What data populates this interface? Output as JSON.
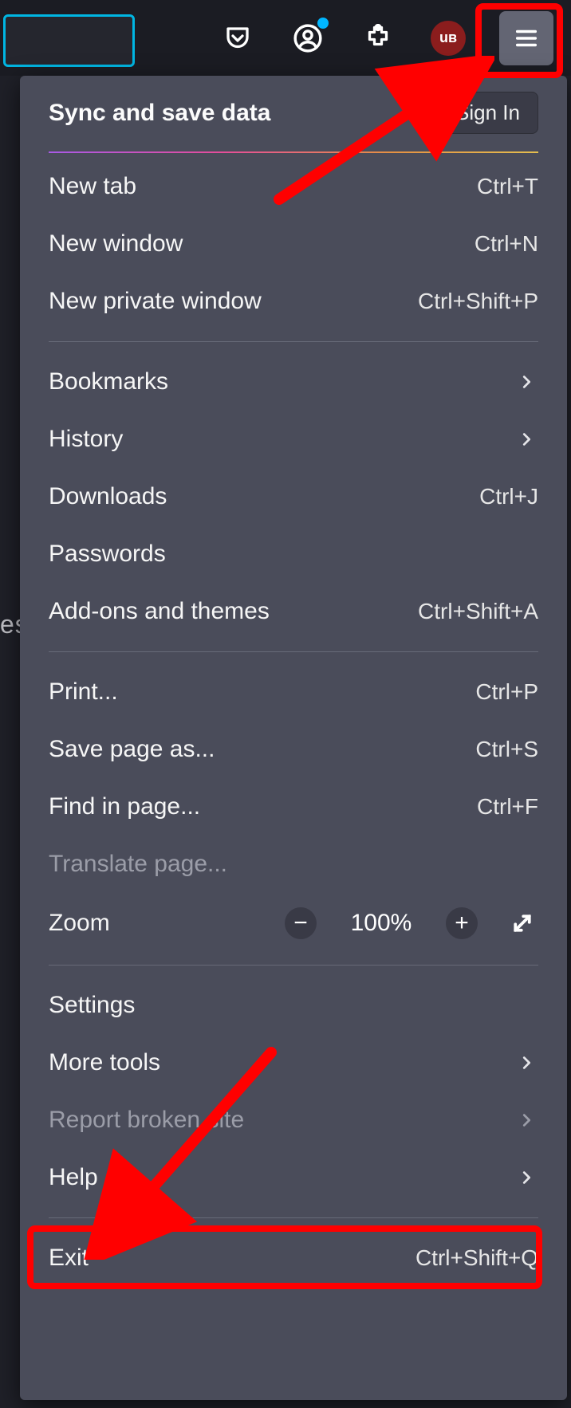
{
  "toolbar": {
    "icons": {
      "pocket": "pocket-icon",
      "account": "account-icon",
      "extensions": "extensions-icon",
      "ublock": "uBO",
      "menu": "hamburger-icon"
    }
  },
  "menu": {
    "sync_title": "Sync and save data",
    "signin_label": "Sign In",
    "items": {
      "new_tab": {
        "label": "New tab",
        "shortcut": "Ctrl+T"
      },
      "new_window": {
        "label": "New window",
        "shortcut": "Ctrl+N"
      },
      "new_private": {
        "label": "New private window",
        "shortcut": "Ctrl+Shift+P"
      },
      "bookmarks": {
        "label": "Bookmarks"
      },
      "history": {
        "label": "History"
      },
      "downloads": {
        "label": "Downloads",
        "shortcut": "Ctrl+J"
      },
      "passwords": {
        "label": "Passwords"
      },
      "addons": {
        "label": "Add-ons and themes",
        "shortcut": "Ctrl+Shift+A"
      },
      "print": {
        "label": "Print...",
        "shortcut": "Ctrl+P"
      },
      "save_as": {
        "label": "Save page as...",
        "shortcut": "Ctrl+S"
      },
      "find": {
        "label": "Find in page...",
        "shortcut": "Ctrl+F"
      },
      "translate": {
        "label": "Translate page..."
      },
      "zoom": {
        "label": "Zoom",
        "value": "100%"
      },
      "settings": {
        "label": "Settings"
      },
      "more_tools": {
        "label": "More tools"
      },
      "report": {
        "label": "Report broken site"
      },
      "help": {
        "label": "Help"
      },
      "exit": {
        "label": "Exit",
        "shortcut": "Ctrl+Shift+Q"
      }
    }
  },
  "annotations": {
    "highlight_color": "#ff0000"
  },
  "bg_peek": "es"
}
